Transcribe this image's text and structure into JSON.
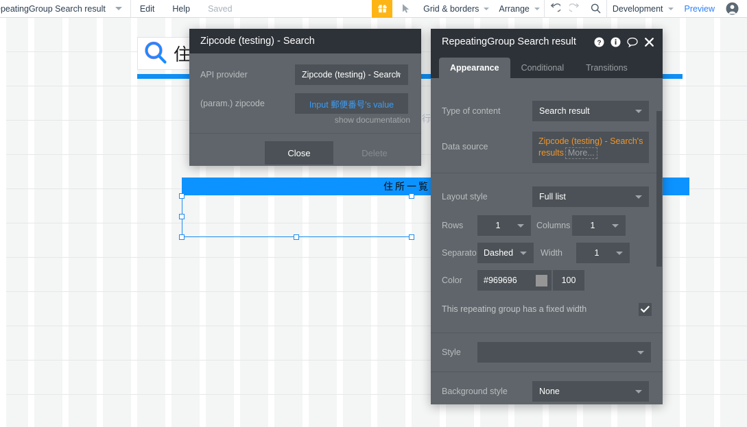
{
  "topbar": {
    "page_title": "epeatingGroup Search result",
    "dropdown_caret_icon": "chevron-down-icon",
    "edit_label": "Edit",
    "help_label": "Help",
    "saved_label": "Saved",
    "gift_icon": "gift-icon",
    "cursor_icon": "cursor-arrow-icon",
    "grid_borders_label": "Grid & borders",
    "arrange_label": "Arrange",
    "undo_icon": "undo-icon",
    "redo_icon": "redo-icon",
    "search_icon": "search-icon",
    "environment_label": "Development",
    "preview_label": "Preview",
    "avatar_icon": "user-avatar-icon"
  },
  "canvas": {
    "search_element": {
      "icon": "magnifier-icon",
      "text": "住所"
    },
    "repeating_group_bar_text": "住所一覧",
    "faint_vertical_text": "行",
    "selection_handles": 6
  },
  "zip_dialog": {
    "title": "Zipcode (testing) - Search",
    "api_provider_label": "API provider",
    "api_provider_value": "Zipcode (testing) - Search",
    "param_label": "(param.) zipcode",
    "param_value": "Input 郵便番号's value",
    "show_documentation_label": "show documentation",
    "close_label": "Close",
    "delete_label": "Delete"
  },
  "rg_panel": {
    "title": "RepeatingGroup Search result",
    "help_icon": "question-circle-icon",
    "info_icon": "info-circle-icon",
    "comment_icon": "speech-bubble-icon",
    "close_icon": "close-icon",
    "tabs": [
      {
        "label": "Appearance",
        "active": true
      },
      {
        "label": "Conditional",
        "active": false
      },
      {
        "label": "Transitions",
        "active": false
      }
    ],
    "type_of_content_label": "Type of content",
    "type_of_content_value": "Search result",
    "data_source_label": "Data source",
    "data_source_value": "Zipcode (testing) - Search's results",
    "data_source_more_label": "More...",
    "data_source_color": "#f0952c",
    "layout_style_label": "Layout style",
    "layout_style_value": "Full list",
    "rows_label": "Rows",
    "rows_value": "1",
    "columns_label": "Columns",
    "columns_value": "1",
    "separator_label": "Separato",
    "separator_value": "Dashed",
    "width_label": "Width",
    "width_value": "1",
    "color_label": "Color",
    "color_value": "#969696",
    "color_swatch": "#969696",
    "opacity_value": "100",
    "fixed_width_label": "This repeating group has a fixed width",
    "fixed_width_checked": true,
    "check_icon": "checkmark-icon",
    "style_label": "Style",
    "style_value": "",
    "background_style_label": "Background style",
    "background_style_value": "None"
  }
}
